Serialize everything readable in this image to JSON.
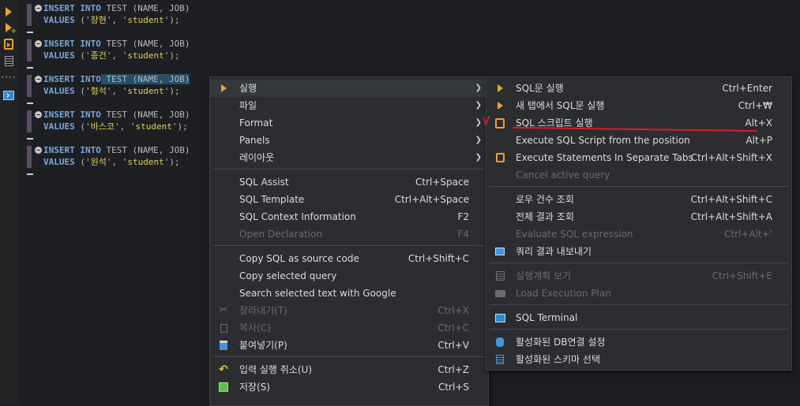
{
  "editor": {
    "blocks": [
      {
        "keyword1": "INSERT",
        "keyword2": "INTO",
        "rest1": " TEST (NAME, JOB)",
        "values_kw": "VALUES",
        "values_rest_pre": " ('",
        "name": "장현",
        "values_mid": "', '",
        "job": "student",
        "values_end": "');"
      },
      {
        "keyword1": "INSERT",
        "keyword2": "INTO",
        "rest1": " TEST (NAME, JOB)",
        "values_kw": "VALUES",
        "values_rest_pre": " ('",
        "name": "종건",
        "values_mid": "', '",
        "job": "student",
        "values_end": "');"
      },
      {
        "keyword1": "INSERT",
        "keyword2": "INTO",
        "rest1": " TEST (NAME, JOB)",
        "values_kw": "VALUES",
        "values_rest_pre": " ('",
        "name": "형석",
        "values_mid": "', '",
        "job": "student",
        "values_end": "');"
      },
      {
        "keyword1": "INSERT",
        "keyword2": "INTO",
        "rest1": " TEST (NAME, JOB)",
        "values_kw": "VALUES",
        "values_rest_pre": " ('",
        "name": "바스코",
        "values_mid": "', '",
        "job": "student",
        "values_end": "');"
      },
      {
        "keyword1": "INSERT",
        "keyword2": "INTO",
        "rest1": " TEST (NAME, JOB)",
        "values_kw": "VALUES",
        "values_rest_pre": " ('",
        "name": "원석",
        "values_mid": "', '",
        "job": "student",
        "values_end": "');"
      }
    ]
  },
  "context_menu": {
    "items": [
      {
        "label": "실행",
        "shortcut": "",
        "submenu": true
      },
      {
        "label": "파일",
        "shortcut": "",
        "submenu": true
      },
      {
        "label": "Format",
        "shortcut": "",
        "submenu": true
      },
      {
        "label": "Panels",
        "shortcut": "",
        "submenu": true
      },
      {
        "label": "레이아웃",
        "shortcut": "",
        "submenu": true
      },
      {
        "label": "SQL Assist",
        "shortcut": "Ctrl+Space"
      },
      {
        "label": "SQL Template",
        "shortcut": "Ctrl+Alt+Space"
      },
      {
        "label": "SQL Context Information",
        "shortcut": "F2"
      },
      {
        "label": "Open Declaration",
        "shortcut": "F4"
      },
      {
        "label": "Copy SQL as source code",
        "shortcut": "Ctrl+Shift+C"
      },
      {
        "label": "Copy selected query",
        "shortcut": ""
      },
      {
        "label": "Search selected text with Google",
        "shortcut": ""
      },
      {
        "label": "잘라내기(T)",
        "shortcut": "Ctrl+X"
      },
      {
        "label": "복사(C)",
        "shortcut": "Ctrl+C"
      },
      {
        "label": "붙여넣기(P)",
        "shortcut": "Ctrl+V"
      },
      {
        "label": "입력 실행 취소(U)",
        "shortcut": "Ctrl+Z"
      },
      {
        "label": "저장(S)",
        "shortcut": "Ctrl+S"
      }
    ]
  },
  "submenu": {
    "items": [
      {
        "label": "SQL문 실행",
        "shortcut": "Ctrl+Enter"
      },
      {
        "label": "새 탭에서 SQL문 실행",
        "shortcut": "Ctrl+₩"
      },
      {
        "label": "SQL 스크립트 실행",
        "shortcut": "Alt+X"
      },
      {
        "label": "Execute SQL Script from the position",
        "shortcut": "Alt+P"
      },
      {
        "label": "Execute Statements In Separate Tabs",
        "shortcut": "Ctrl+Alt+Shift+X"
      },
      {
        "label": "Cancel active query",
        "shortcut": ""
      },
      {
        "label": "로우 건수 조회",
        "shortcut": "Ctrl+Alt+Shift+C"
      },
      {
        "label": "전체 결과 조회",
        "shortcut": "Ctrl+Alt+Shift+A"
      },
      {
        "label": "Evaluate SQL expression",
        "shortcut": "Ctrl+Alt+'"
      },
      {
        "label": "쿼리 결과 내보내기",
        "shortcut": ""
      },
      {
        "label": "실행계획 보기",
        "shortcut": "Ctrl+Shift+E"
      },
      {
        "label": "Load Execution Plan",
        "shortcut": ""
      },
      {
        "label": "SQL Terminal",
        "shortcut": ""
      },
      {
        "label": "활성화된 DB연결 설정",
        "shortcut": ""
      },
      {
        "label": "활성화된 스키마 선택",
        "shortcut": ""
      }
    ]
  },
  "colors": {
    "keyword": "#7aa6da",
    "string": "#e0d060",
    "accent": "#f0a030",
    "annotation": "#d0202a"
  },
  "icons": [
    "run-icon",
    "run-new-tab-icon",
    "script-icon",
    "document-icon",
    "terminal-icon"
  ]
}
